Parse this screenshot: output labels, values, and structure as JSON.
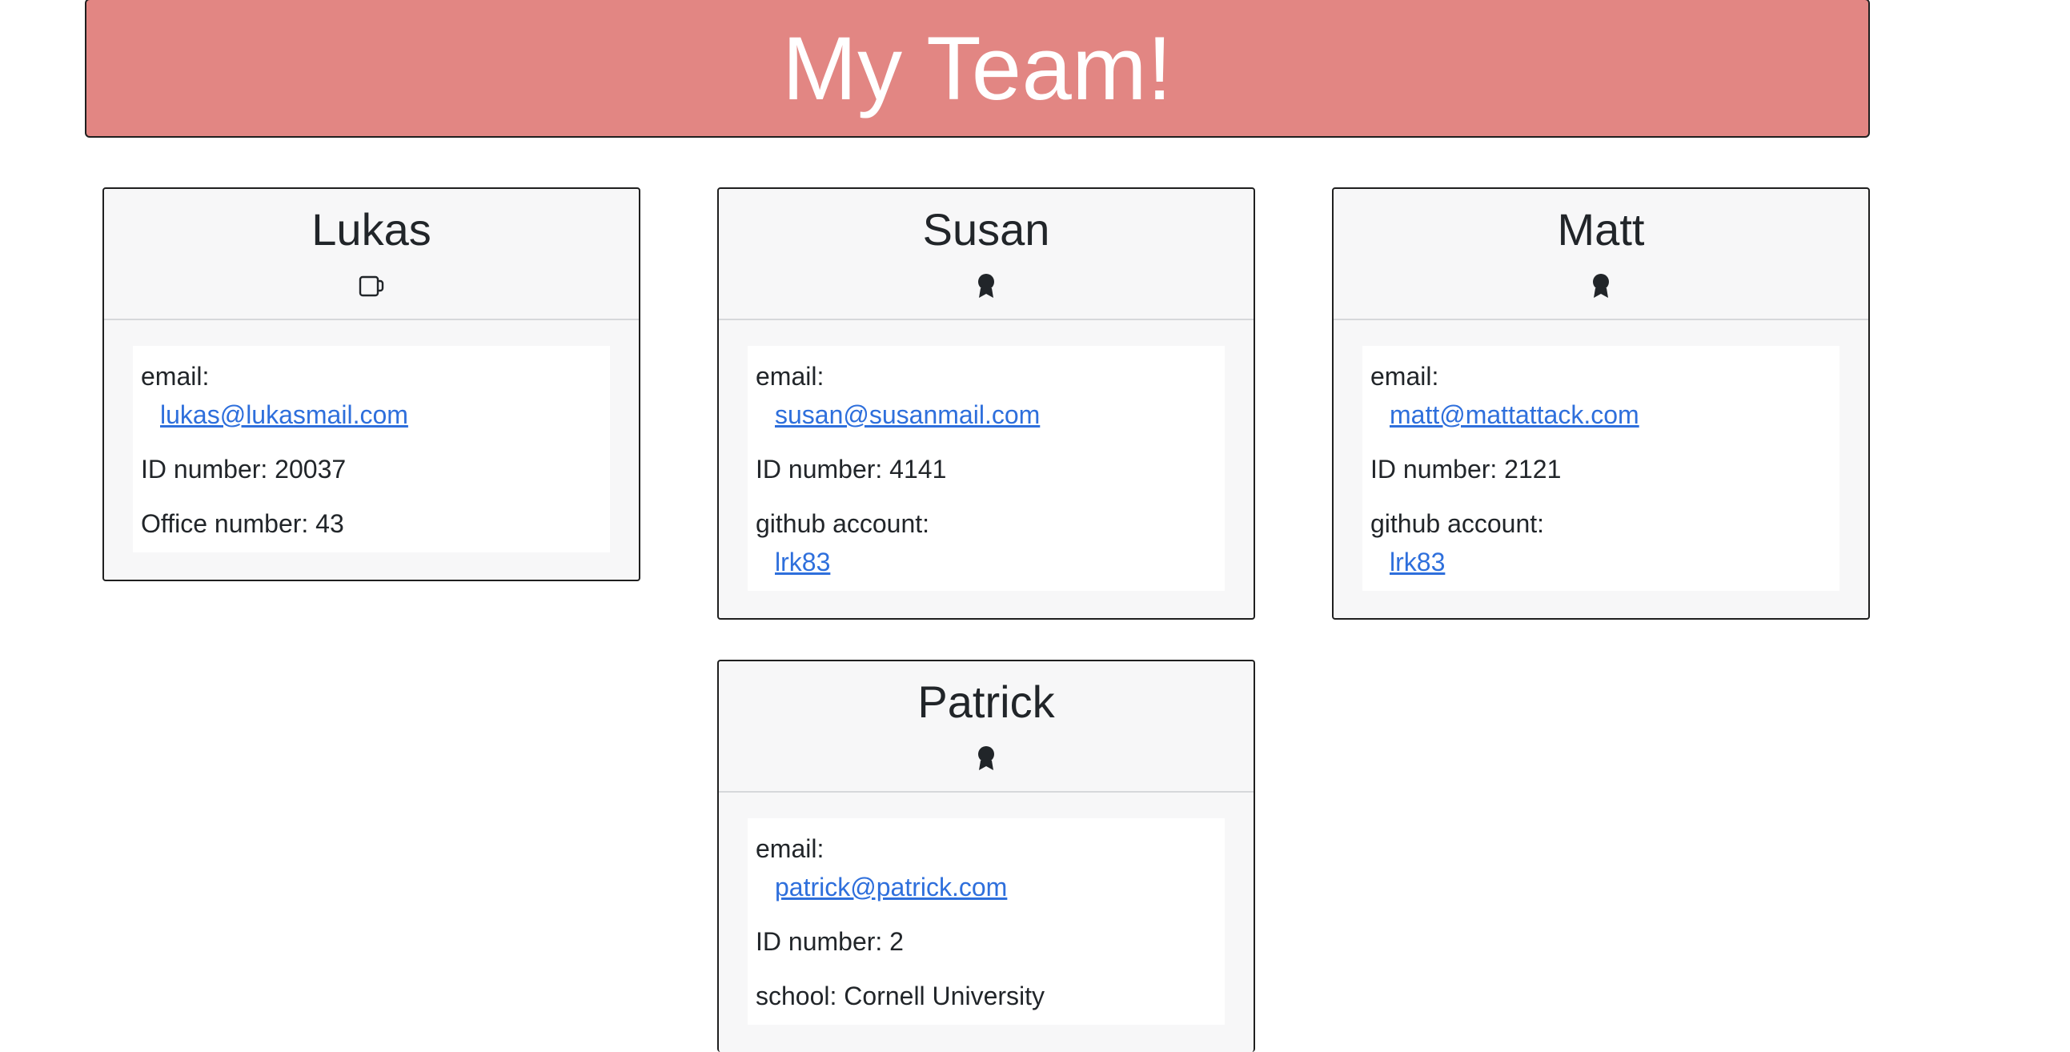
{
  "header": {
    "title": "My Team!"
  },
  "team": [
    {
      "name": "Lukas",
      "role_icon": "mug-icon",
      "email_label": "email:",
      "email": "lukas@lukasmail.com",
      "id_label": "ID number: 20037",
      "extra_label": "Office number: 43"
    },
    {
      "name": "Susan",
      "role_icon": "engineer-badge-icon",
      "email_label": "email:",
      "email": "susan@susanmail.com",
      "id_label": "ID number: 4141",
      "github_label": "github account:",
      "github": "lrk83"
    },
    {
      "name": "Matt",
      "role_icon": "engineer-badge-icon",
      "email_label": "email:",
      "email": "matt@mattattack.com",
      "id_label": "ID number: 2121",
      "github_label": "github account:",
      "github": "lrk83"
    },
    {
      "name": "Patrick",
      "role_icon": "intern-badge-icon",
      "email_label": "email:",
      "email": "patrick@patrick.com",
      "id_label": "ID number: 2",
      "extra_label": "school: Cornell University"
    }
  ],
  "colors": {
    "header_bg": "#e28683",
    "link": "#2e6fdc",
    "card_bg": "#f7f7f8"
  }
}
